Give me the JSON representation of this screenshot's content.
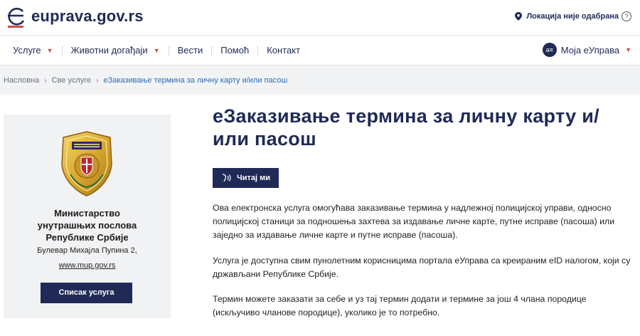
{
  "header": {
    "logo_text": "euprava.gov.rs",
    "location_label": "Локација није одабрана",
    "help_glyph": "?"
  },
  "nav": {
    "items": [
      {
        "label": "Услуге",
        "has_dropdown": true
      },
      {
        "label": "Животни догађаји",
        "has_dropdown": true
      },
      {
        "label": "Вести",
        "has_dropdown": false
      },
      {
        "label": "Помоћ",
        "has_dropdown": false
      },
      {
        "label": "Контакт",
        "has_dropdown": false
      }
    ],
    "account_label": "Моја еУправа",
    "avatar_glyph": "a≡"
  },
  "breadcrumb": {
    "items": [
      "Насловна",
      "Све услуге",
      "еЗаказивање термина за личну карту и/или пасош"
    ]
  },
  "sidebar": {
    "org_name_lines": [
      "Министарство",
      "унутрашњих послова",
      "Републике Србије"
    ],
    "address": "Булевар Михајла Пупина 2,",
    "website": "www.mup.gov.rs",
    "services_button": "Списак услуга"
  },
  "main": {
    "title_line1": "еЗаказивање термина за личну карту и/",
    "title_line2": "или пасош",
    "read_button": "Читај ми",
    "paragraphs": [
      "Ова електронска услуга омогућава заказивање термина у надлежној полицијској управи, односно полицијској станици за подношења захтева за издавање личне карте, путне исправе (пасоша) или заједно за издавање личне карте и путне исправе (пасоша).",
      "Услуга је доступна свим пунолетним корисницима портала еУправа са креираним eID налогом, који су држављани Републике Србије.",
      "Термин можете заказати за себе и уз тај термин додати и термине за још 4 члана породице (искључиво чланове породице), уколико је то потребно.",
      ""
    ]
  },
  "colors": {
    "brand_navy": "#1f2a57",
    "accent_red": "#d04a4a",
    "link_blue": "#2c6bb5",
    "card_bg": "#f1f2f4"
  },
  "icons": {
    "logo": "euprava-logo-icon",
    "location": "map-pin-icon",
    "help": "question-circle-icon",
    "chevron": "chevron-down-icon",
    "breadcrumb_sep": "chevron-right-icon",
    "speak": "speaker-icon",
    "emblem": "ministry-emblem"
  }
}
